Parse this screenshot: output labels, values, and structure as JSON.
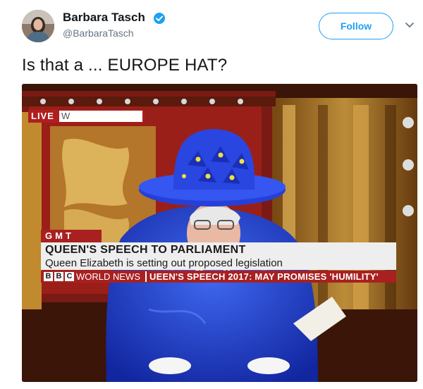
{
  "author": {
    "name": "Barbara Tasch",
    "handle": "@BarbaraTasch",
    "verified": true
  },
  "follow_label": "Follow",
  "tweet_text": "Is that a ... EUROPE HAT?",
  "broadcast": {
    "live_label": "LIVE",
    "live_partial": "W",
    "gmt_label": "GMT",
    "headline": "QUEEN'S SPEECH TO PARLIAMENT",
    "subline": "Queen Elizabeth is setting out proposed legislation",
    "channel_letters": [
      "B",
      "B",
      "C"
    ],
    "channel_name": "WORLD NEWS",
    "ticker": "UEEN'S SPEECH 2017: MAY PROMISES 'HUMILITY'"
  },
  "colors": {
    "accent": "#1da1f2",
    "bbc_red": "#a82020",
    "hat_blue": "#1f3fd0"
  },
  "icons": {
    "verified": "verified-badge-icon",
    "chevron": "chevron-down-icon"
  }
}
